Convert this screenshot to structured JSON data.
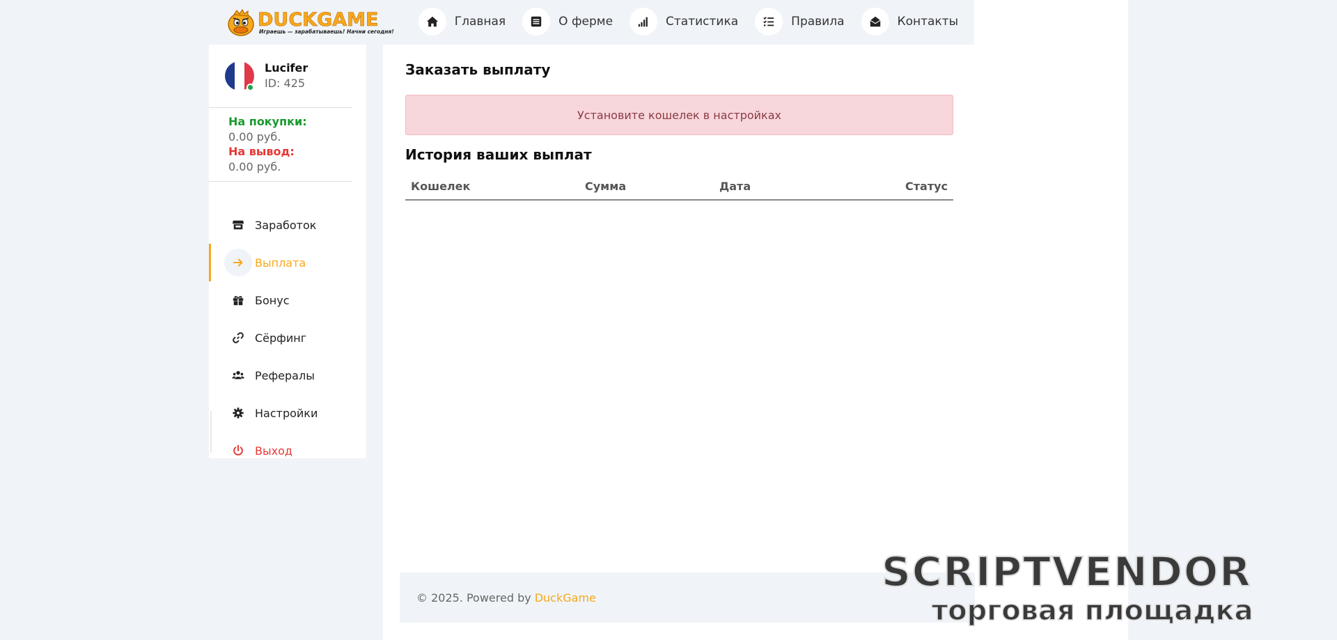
{
  "logo": {
    "name": "DUCKGAME",
    "tagline": "Играешь — зарабатываешь! Начни сегодня!"
  },
  "nav": [
    {
      "label": "Главная",
      "icon": "home-icon"
    },
    {
      "label": "О ферме",
      "icon": "list-icon"
    },
    {
      "label": "Статистика",
      "icon": "signal-icon"
    },
    {
      "label": "Правила",
      "icon": "checklist-icon"
    },
    {
      "label": "Контакты",
      "icon": "envelope-open-icon"
    }
  ],
  "user": {
    "name": "Lucifer",
    "id": "ID: 425",
    "flag": "france-flag-icon"
  },
  "balance": {
    "purchase_label": "На покупки:",
    "purchase_value": "0.00 руб.",
    "withdraw_label": "На вывод:",
    "withdraw_value": "0.00 руб."
  },
  "menu": [
    {
      "label": "Заработок",
      "icon": "store-icon",
      "active": false
    },
    {
      "label": "Выплата",
      "icon": "arrow-right-icon",
      "active": true
    },
    {
      "label": "Бонус",
      "icon": "gift-icon",
      "active": false
    },
    {
      "label": "Сёрфинг",
      "icon": "link-icon",
      "active": false
    },
    {
      "label": "Рефералы",
      "icon": "users-icon",
      "active": false
    },
    {
      "label": "Настройки",
      "icon": "gear-icon",
      "active": false
    },
    {
      "label": "Выход",
      "icon": "power-icon",
      "active": false
    }
  ],
  "main": {
    "title": "Заказать выплату",
    "alert": "Установите кошелек в настройках",
    "history_title": "История ваших выплат",
    "columns": [
      "Кошелек",
      "Сумма",
      "Дата",
      "Статус"
    ]
  },
  "footer": {
    "text": "© 2025. Powered by",
    "brand": "DuckGame"
  },
  "watermark": {
    "top": "SCRIPTVENDOR",
    "bottom": "торговая площадка"
  },
  "colors": {
    "accent": "#f7a81b",
    "positive": "#1a9a2e",
    "negative": "#e53935",
    "background": "#f0f4f8"
  }
}
